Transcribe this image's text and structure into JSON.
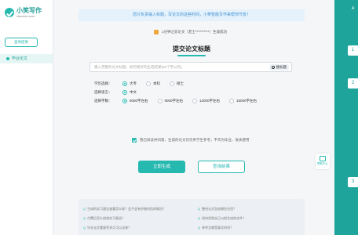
{
  "sidebar": {
    "logo_name": "小笑写作",
    "logo_domain": "xiaoxiao.com",
    "query_button": "查询结果",
    "active_item": "毕业论文"
  },
  "banner": "您只负责输入标题，写论文的这些时间，小笑智能写作来帮你节省！",
  "notice": "1分钟之前论文（若士**********）生成成功",
  "title": "提交论文标题",
  "search": {
    "placeholder": "输入完整的论文标题，如何更好的生成结果(50个字以内)",
    "button": "搜标题"
  },
  "form": {
    "degree": {
      "label": "学历选择：",
      "options": [
        "大专",
        "本科",
        "硕士"
      ],
      "selected": 0
    },
    "language": {
      "label": "选择语言：",
      "options": [
        "中文"
      ],
      "selected": 0
    },
    "words": {
      "label": "选择字数：",
      "options": [
        "8000字左右",
        "9000字左右",
        "12000字左右",
        "15000字左右"
      ],
      "selected": 0
    }
  },
  "agreement": "我已阅读并同意，生成的论文仅仅供学生参考，不作为毕业、发表使用",
  "buttons": {
    "generate": "立即生成",
    "query": "查询结果"
  },
  "faq": {
    "q_mark": "Q",
    "left": [
      "生成的实习报告查重怎么样？会不会有抄袭风险的情况？",
      "付费后怎么修改实习报告？",
      "毕业论文重复率多久可以出来？"
    ],
    "right": [
      "整份论文包括哪些东西？",
      "如何找到自己以前生成的文件？",
      "参考文献是真实的吗？"
    ]
  },
  "right_panel": {
    "steps": [
      "1",
      "2",
      "3"
    ],
    "top_char": "A"
  },
  "float_widget": "帮助中心",
  "colors": {
    "accent": "#26b9b0",
    "right_panel": "#1fa49b",
    "banner_bg": "#e6f2fb"
  }
}
